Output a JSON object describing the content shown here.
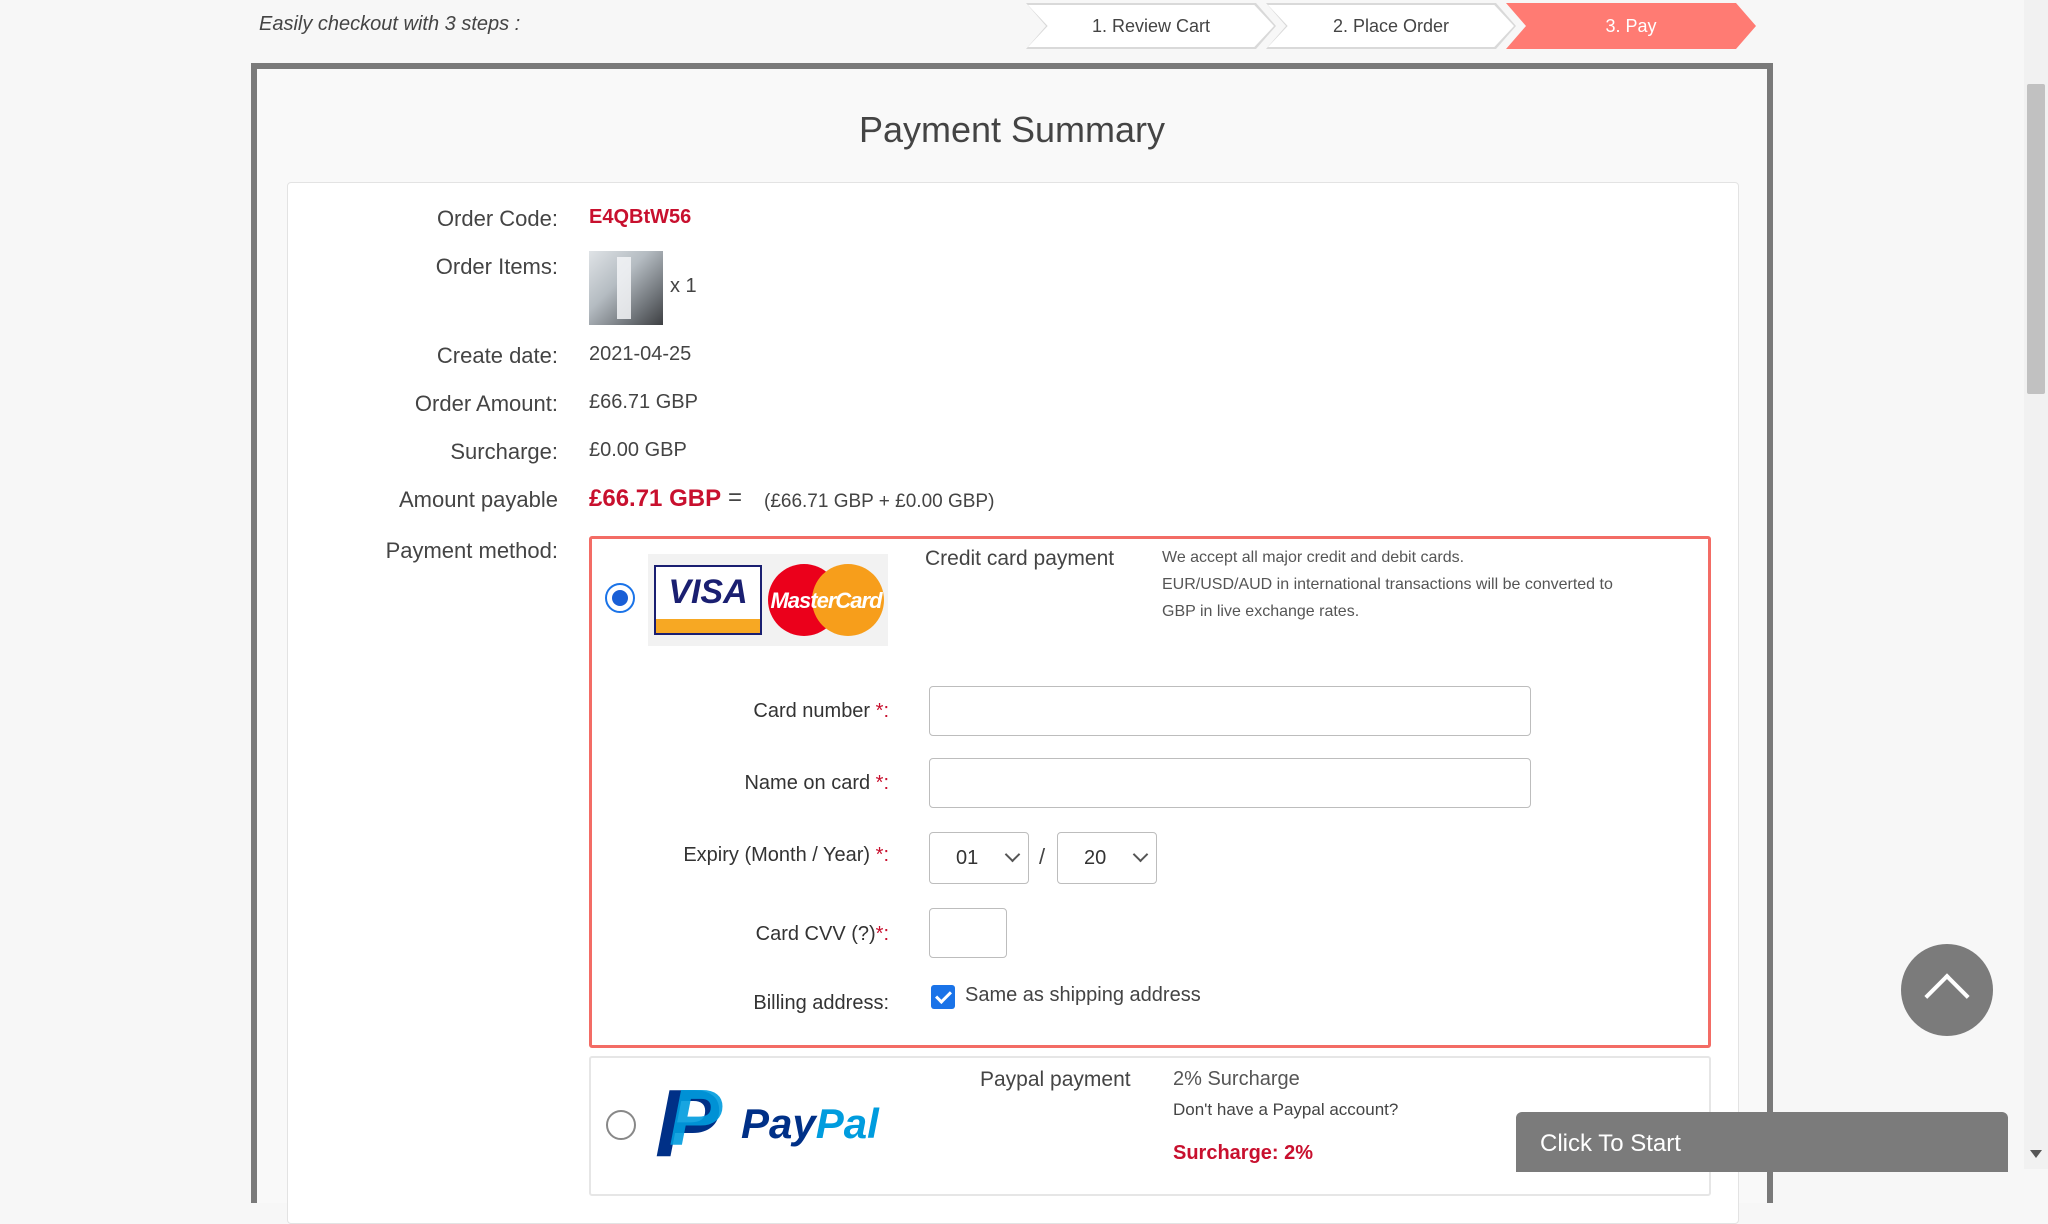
{
  "header": {
    "tagline": "Easily checkout with 3 steps :",
    "steps": [
      {
        "label": "1. Review Cart"
      },
      {
        "label": "2. Place Order"
      },
      {
        "label": "3. Pay"
      }
    ],
    "active_step_color": "#ff7b73"
  },
  "summary": {
    "title": "Payment Summary",
    "order_code_label": "Order Code:",
    "order_code": "E4QBtW56",
    "order_items_label": "Order Items:",
    "item_qty": "x 1",
    "create_date_label": "Create date:",
    "create_date": "2021-04-25",
    "order_amount_label": "Order Amount:",
    "order_amount": "£66.71 GBP",
    "surcharge_label": "Surcharge:",
    "surcharge": "£0.00 GBP",
    "amount_payable_label": "Amount payable",
    "amount_payable": "£66.71 GBP",
    "equals": "=",
    "amount_breakdown": "(£66.71 GBP + £0.00 GBP)",
    "payment_method_label": "Payment method:"
  },
  "credit_card": {
    "title": "Credit card payment",
    "desc_line1": "We accept all major credit and debit cards.",
    "desc_line2": "EUR/USD/AUD in international transactions will be converted to",
    "desc_line3": "GBP in live exchange rates.",
    "visa_text": "VISA",
    "mastercard_text": "MasterCard",
    "card_number_label": "Card number ",
    "name_on_card_label": "Name on card ",
    "expiry_label": "Expiry (Month / Year) ",
    "cvv_label": "Card CVV (?)",
    "required_mark": "*:",
    "expiry_month": "01",
    "expiry_year": "20",
    "slash": "/",
    "billing_label": "Billing address:",
    "same_as_shipping": "Same as shipping address",
    "selected": true
  },
  "paypal": {
    "logo_text_a": "Pay",
    "logo_text_b": "Pal",
    "logo_mark": "P",
    "title": "Paypal payment",
    "surcharge_note": "2% Surcharge",
    "account_question": "Don't have a Paypal account?",
    "surcharge_red": "Surcharge: 2%"
  },
  "widgets": {
    "click_to_start": "Click To Start"
  },
  "colors": {
    "accent_red": "#c8102e",
    "selected_border": "#f36c65",
    "checkbox_blue": "#1a73e8"
  }
}
